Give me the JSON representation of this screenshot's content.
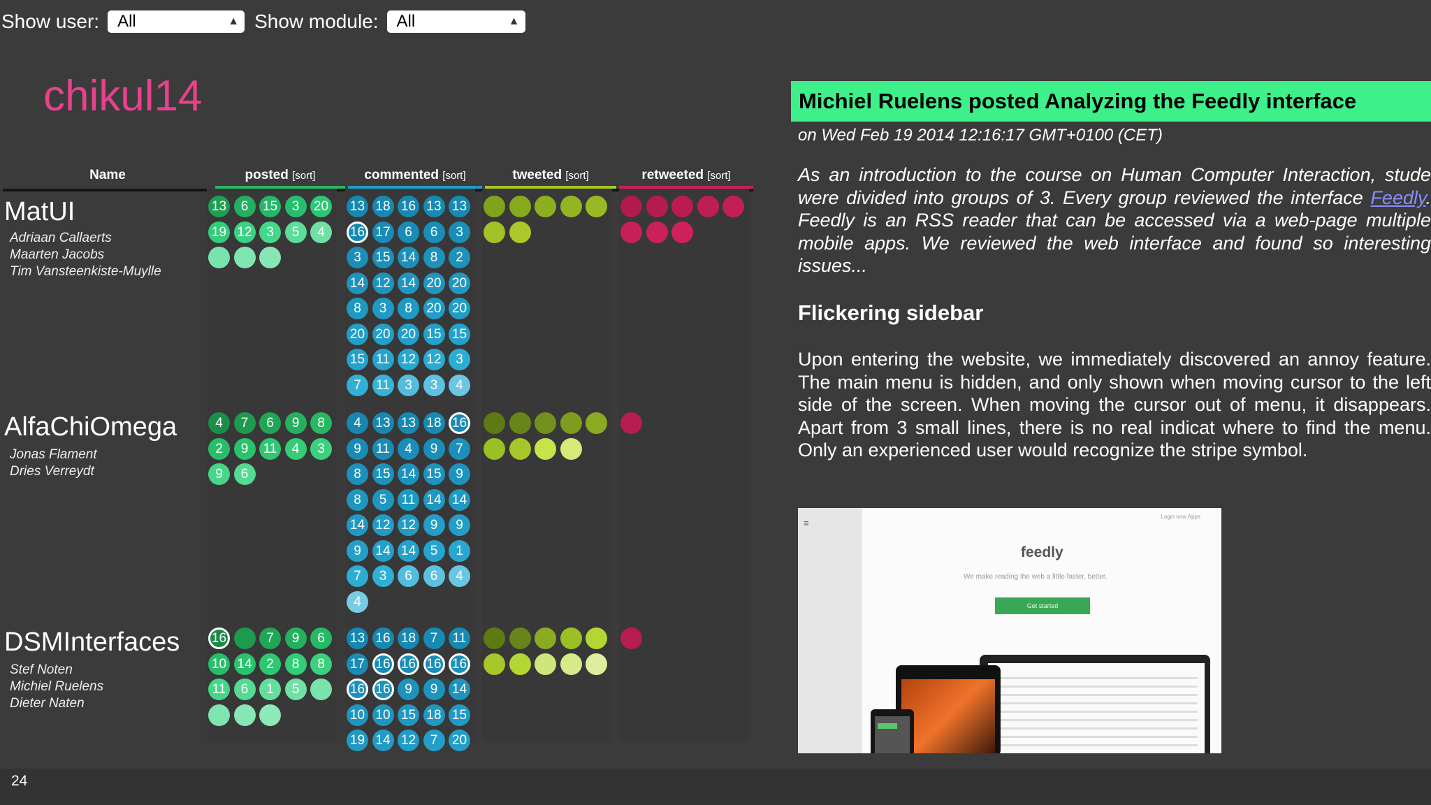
{
  "filters": {
    "user_label": "Show user:",
    "user_value": "All",
    "module_label": "Show module:",
    "module_value": "All"
  },
  "brand": "chikul14",
  "columns": {
    "name": "Name",
    "posted": "posted",
    "commented": "commented",
    "tweeted": "tweeted",
    "retweeted": "retweeted",
    "sort": "[sort]"
  },
  "colors": {
    "posted_header": "#2ab56a",
    "commented_header": "#1f9ac4",
    "tweeted_header": "#a6c72a",
    "retweeted_header": "#cb1f5a",
    "title_bg": "#3ef089",
    "brand": "#e8418d"
  },
  "groups": [
    {
      "name": "MatUI",
      "members": [
        "Adriaan Callaerts",
        "Maarten Jacobs",
        "Tim Vansteenkiste-Muylle"
      ],
      "posted": [
        {
          "v": "13",
          "c": "#1f9e52"
        },
        {
          "v": "6",
          "c": "#22b060"
        },
        {
          "v": "15",
          "c": "#23b768"
        },
        {
          "v": "3",
          "c": "#26be6e"
        },
        {
          "v": "20",
          "c": "#2cc774"
        },
        {
          "v": "19",
          "c": "#33cd7a"
        },
        {
          "v": "12",
          "c": "#3bd283"
        },
        {
          "v": "3",
          "c": "#46d78c"
        },
        {
          "v": "5",
          "c": "#5bdc98"
        },
        {
          "v": "4",
          "c": "#6fe1a5"
        },
        {
          "v": "",
          "c": "#78e3ab"
        },
        {
          "v": "",
          "c": "#7fe5b0"
        },
        {
          "v": "",
          "c": "#86e7b5"
        }
      ],
      "commented": [
        {
          "v": "13",
          "c": "#1687b0"
        },
        {
          "v": "18",
          "c": "#1788b2"
        },
        {
          "v": "16",
          "c": "#1788b2"
        },
        {
          "v": "13",
          "c": "#178ab4"
        },
        {
          "v": "13",
          "c": "#178ab4"
        },
        {
          "v": "16",
          "c": "#178ab4",
          "ring": true
        },
        {
          "v": "17",
          "c": "#198cb6"
        },
        {
          "v": "6",
          "c": "#198cb6"
        },
        {
          "v": "6",
          "c": "#1a8eb8"
        },
        {
          "v": "3",
          "c": "#1a8eb8"
        },
        {
          "v": "3",
          "c": "#1a8eb8"
        },
        {
          "v": "15",
          "c": "#1b90ba"
        },
        {
          "v": "14",
          "c": "#1b90ba"
        },
        {
          "v": "8",
          "c": "#1c92bc"
        },
        {
          "v": "2",
          "c": "#1c92bc"
        },
        {
          "v": "14",
          "c": "#1d94be"
        },
        {
          "v": "12",
          "c": "#1d94be"
        },
        {
          "v": "14",
          "c": "#1e96c0"
        },
        {
          "v": "20",
          "c": "#1e96c0"
        },
        {
          "v": "20",
          "c": "#1f98c2"
        },
        {
          "v": "8",
          "c": "#1f98c2"
        },
        {
          "v": "3",
          "c": "#209ac4"
        },
        {
          "v": "8",
          "c": "#209ac4"
        },
        {
          "v": "20",
          "c": "#219cc6"
        },
        {
          "v": "20",
          "c": "#219cc6"
        },
        {
          "v": "20",
          "c": "#229ec8"
        },
        {
          "v": "20",
          "c": "#229ec8"
        },
        {
          "v": "20",
          "c": "#23a0ca"
        },
        {
          "v": "15",
          "c": "#23a0ca"
        },
        {
          "v": "15",
          "c": "#24a2cc"
        },
        {
          "v": "15",
          "c": "#24a2cc"
        },
        {
          "v": "11",
          "c": "#25a5ce"
        },
        {
          "v": "12",
          "c": "#27a8d0"
        },
        {
          "v": "12",
          "c": "#29aad2"
        },
        {
          "v": "3",
          "c": "#2cadd4"
        },
        {
          "v": "7",
          "c": "#30b0d6"
        },
        {
          "v": "11",
          "c": "#36b3d8"
        },
        {
          "v": "3",
          "c": "#52bddd"
        },
        {
          "v": "3",
          "c": "#5ec1df"
        },
        {
          "v": "4",
          "c": "#6ac6e2"
        }
      ],
      "tweeted": [
        {
          "v": "",
          "c": "#7fa31c"
        },
        {
          "v": "",
          "c": "#86aa1d"
        },
        {
          "v": "",
          "c": "#8caf20"
        },
        {
          "v": "",
          "c": "#93b522"
        },
        {
          "v": "",
          "c": "#99b924"
        },
        {
          "v": "",
          "c": "#a2c227"
        },
        {
          "v": "",
          "c": "#aac82a"
        }
      ],
      "retweeted": [
        {
          "v": "",
          "c": "#b01a4d"
        },
        {
          "v": "",
          "c": "#b51b50"
        },
        {
          "v": "",
          "c": "#ba1c52"
        },
        {
          "v": "",
          "c": "#bf1d55"
        },
        {
          "v": "",
          "c": "#c41e57"
        },
        {
          "v": "",
          "c": "#c81f59"
        },
        {
          "v": "",
          "c": "#cc205b"
        },
        {
          "v": "",
          "c": "#d0215d"
        }
      ]
    },
    {
      "name": "AlfaChiOmega",
      "members": [
        "Jonas Flament",
        "Dries Verreydt"
      ],
      "posted": [
        {
          "v": "4",
          "c": "#1b8e49"
        },
        {
          "v": "7",
          "c": "#1e9a50"
        },
        {
          "v": "6",
          "c": "#21a658"
        },
        {
          "v": "9",
          "c": "#24b05f"
        },
        {
          "v": "8",
          "c": "#26b863"
        },
        {
          "v": "2",
          "c": "#28be69"
        },
        {
          "v": "9",
          "c": "#2ac36d"
        },
        {
          "v": "11",
          "c": "#2fc872"
        },
        {
          "v": "4",
          "c": "#33cc77"
        },
        {
          "v": "3",
          "c": "#3ad17e"
        },
        {
          "v": "9",
          "c": "#46d68a"
        },
        {
          "v": "6",
          "c": "#55da93"
        }
      ],
      "commented": [
        {
          "v": "4",
          "c": "#1687b0"
        },
        {
          "v": "13",
          "c": "#1788b2"
        },
        {
          "v": "13",
          "c": "#1788b2"
        },
        {
          "v": "18",
          "c": "#178ab4"
        },
        {
          "v": "16",
          "c": "#178ab4",
          "ring": true
        },
        {
          "v": "9",
          "c": "#198cb6"
        },
        {
          "v": "11",
          "c": "#198cb6"
        },
        {
          "v": "4",
          "c": "#1a8eb8"
        },
        {
          "v": "9",
          "c": "#1a8eb8"
        },
        {
          "v": "7",
          "c": "#1b90ba"
        },
        {
          "v": "8",
          "c": "#1b90ba"
        },
        {
          "v": "15",
          "c": "#1c92bc"
        },
        {
          "v": "14",
          "c": "#1c92bc"
        },
        {
          "v": "15",
          "c": "#1d94be"
        },
        {
          "v": "9",
          "c": "#1d94be"
        },
        {
          "v": "8",
          "c": "#1e96c0"
        },
        {
          "v": "5",
          "c": "#1e96c0"
        },
        {
          "v": "11",
          "c": "#1f98c2"
        },
        {
          "v": "14",
          "c": "#1f98c2"
        },
        {
          "v": "14",
          "c": "#209ac4"
        },
        {
          "v": "14",
          "c": "#209ac4"
        },
        {
          "v": "12",
          "c": "#219cc6"
        },
        {
          "v": "12",
          "c": "#219cc6"
        },
        {
          "v": "9",
          "c": "#229ec8"
        },
        {
          "v": "9",
          "c": "#229ec8"
        },
        {
          "v": "9",
          "c": "#23a0ca"
        },
        {
          "v": "14",
          "c": "#23a0ca"
        },
        {
          "v": "14",
          "c": "#24a2cc"
        },
        {
          "v": "5",
          "c": "#25a5ce"
        },
        {
          "v": "1",
          "c": "#27a8d0"
        },
        {
          "v": "7",
          "c": "#2cadd4"
        },
        {
          "v": "3",
          "c": "#30b0d6"
        },
        {
          "v": "6",
          "c": "#52bddd"
        },
        {
          "v": "6",
          "c": "#5ec1df"
        },
        {
          "v": "4",
          "c": "#6ac6e2"
        },
        {
          "v": "4",
          "c": "#79cbe5"
        }
      ],
      "tweeted": [
        {
          "v": "",
          "c": "#5e7a12"
        },
        {
          "v": "",
          "c": "#67851a"
        },
        {
          "v": "",
          "c": "#72901c"
        },
        {
          "v": "",
          "c": "#7e9d1e"
        },
        {
          "v": "",
          "c": "#8aaa21"
        },
        {
          "v": "",
          "c": "#9ac025"
        },
        {
          "v": "",
          "c": "#a6c72a"
        },
        {
          "v": "",
          "c": "#c6e34a"
        },
        {
          "v": "",
          "c": "#d6ea7a"
        }
      ],
      "retweeted": [
        {
          "v": "",
          "c": "#b81c50"
        }
      ]
    },
    {
      "name": "DSMInterfaces",
      "members": [
        "Stef Noten",
        "Michiel Ruelens",
        "Dieter Naten"
      ],
      "posted": [
        {
          "v": "16",
          "c": "#1a8a47",
          "ring": true
        },
        {
          "v": "",
          "c": "#1c9a50"
        },
        {
          "v": "7",
          "c": "#20a657"
        },
        {
          "v": "9",
          "c": "#24b05f"
        },
        {
          "v": "6",
          "c": "#26b863"
        },
        {
          "v": "10",
          "c": "#28be69"
        },
        {
          "v": "14",
          "c": "#2ac36d"
        },
        {
          "v": "2",
          "c": "#2fc872"
        },
        {
          "v": "8",
          "c": "#33cc77"
        },
        {
          "v": "8",
          "c": "#3ad17e"
        },
        {
          "v": "11",
          "c": "#46d68a"
        },
        {
          "v": "6",
          "c": "#55da93"
        },
        {
          "v": "1",
          "c": "#64de9d"
        },
        {
          "v": "5",
          "c": "#6fe1a5"
        },
        {
          "v": "",
          "c": "#78e3ab"
        },
        {
          "v": "",
          "c": "#7fe5b0"
        },
        {
          "v": "",
          "c": "#86e7b5"
        },
        {
          "v": "",
          "c": "#8de9ba"
        }
      ],
      "commented": [
        {
          "v": "13",
          "c": "#1687b0"
        },
        {
          "v": "16",
          "c": "#1788b2"
        },
        {
          "v": "18",
          "c": "#1788b2"
        },
        {
          "v": "7",
          "c": "#178ab4"
        },
        {
          "v": "11",
          "c": "#178ab4"
        },
        {
          "v": "17",
          "c": "#198cb6"
        },
        {
          "v": "16",
          "c": "#198cb6",
          "ring": true
        },
        {
          "v": "16",
          "c": "#1a8eb8",
          "ring": true
        },
        {
          "v": "16",
          "c": "#1a8eb8",
          "ring": true
        },
        {
          "v": "16",
          "c": "#1b90ba",
          "ring": true
        },
        {
          "v": "16",
          "c": "#1b90ba",
          "ring": true
        },
        {
          "v": "16",
          "c": "#1c92bc",
          "ring": true
        },
        {
          "v": "9",
          "c": "#1c92bc"
        },
        {
          "v": "9",
          "c": "#1d94be"
        },
        {
          "v": "14",
          "c": "#1d94be"
        },
        {
          "v": "10",
          "c": "#1e96c0"
        },
        {
          "v": "10",
          "c": "#1e96c0"
        },
        {
          "v": "15",
          "c": "#1f98c2"
        },
        {
          "v": "18",
          "c": "#1f98c2"
        },
        {
          "v": "15",
          "c": "#209ac4"
        },
        {
          "v": "19",
          "c": "#209ac4"
        },
        {
          "v": "14",
          "c": "#219cc6"
        },
        {
          "v": "12",
          "c": "#219cc6"
        },
        {
          "v": "7",
          "c": "#229ec8"
        },
        {
          "v": "20",
          "c": "#229ec8"
        }
      ],
      "tweeted": [
        {
          "v": "",
          "c": "#5e7a12"
        },
        {
          "v": "",
          "c": "#67851a"
        },
        {
          "v": "",
          "c": "#8aaa21"
        },
        {
          "v": "",
          "c": "#9ac025"
        },
        {
          "v": "",
          "c": "#b5d632"
        },
        {
          "v": "",
          "c": "#a6c72a"
        },
        {
          "v": "",
          "c": "#b5d632"
        },
        {
          "v": "",
          "c": "#cfe67a"
        },
        {
          "v": "",
          "c": "#d6ea8a"
        },
        {
          "v": "",
          "c": "#ddeea0"
        }
      ],
      "retweeted": [
        {
          "v": "",
          "c": "#b81c50"
        }
      ]
    }
  ],
  "post": {
    "title": "Michiel Ruelens posted Analyzing the Feedly interface",
    "date": "on Wed Feb 19 2014 12:16:17 GMT+0100 (CET)",
    "intro_a": "As an introduction to the course on Human Computer Interaction, stude were divided into groups of 3. Every group reviewed the interface",
    "intro_link": "Feedly",
    "intro_b": ". Feedly is an RSS reader that can be accessed via a web-page multiple mobile apps. We reviewed the web interface and found so interesting issues...",
    "subheading": "Flickering sidebar",
    "body": "Upon entering the website, we immediately discovered an annoy feature. The main menu is hidden, and only shown when moving cursor to the left side of the screen. When moving the cursor out of menu, it disappears. Apart from 3 small lines, there is no real indicat where to find the menu. Only an experienced user would recognize the stripe symbol.",
    "screenshot": {
      "logo": "feedly",
      "tagline": "We make reading the web a little faster, better.",
      "cta": "Get started",
      "links": "Login now   Apps",
      "menu_glyph": "≡"
    }
  },
  "page_number": "24"
}
